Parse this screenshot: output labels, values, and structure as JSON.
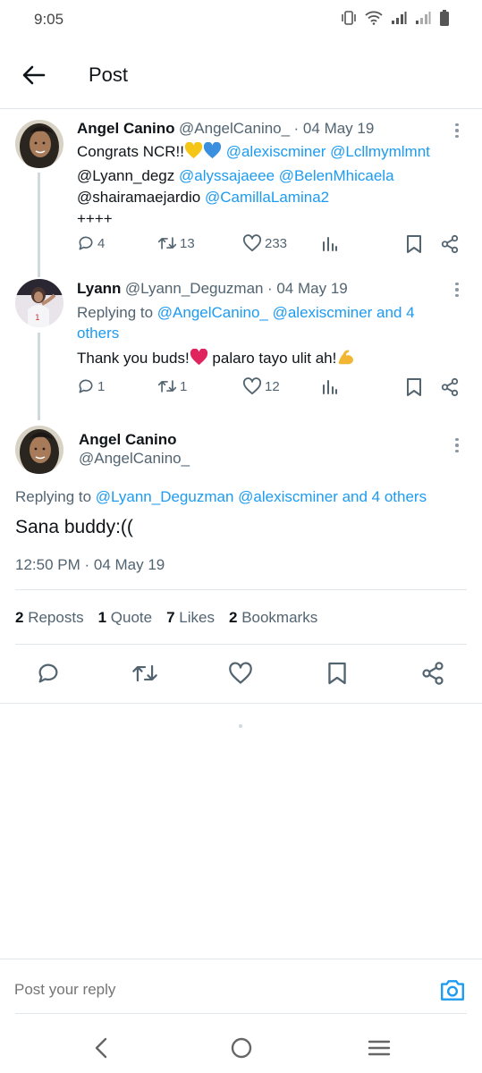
{
  "status_bar": {
    "time": "9:05"
  },
  "header": {
    "title": "Post"
  },
  "tweets": [
    {
      "name": "Angel Canino",
      "handle": "@AngelCanino_",
      "date": "· 04 May 19",
      "text_prefix": "Congrats NCR!!",
      "mentions_line1": "@alexiscminer @Lcllmymlmnt",
      "mentions_line2_plain": "@Lyann_degz",
      "mentions_line2_links": "@alyssajaeee @BelenMhicaela",
      "mentions_line3_plain": "@shairamaejardio",
      "mentions_line3_links": "@CamillaLamina2",
      "text_suffix": "++++",
      "replies": "4",
      "reposts": "13",
      "likes": "233"
    },
    {
      "name": "Lyann",
      "handle": "@Lyann_Deguzman",
      "date": "· 04 May 19",
      "replying_label": "Replying to",
      "replying_links": "@AngelCanino_ @alexiscminer and 4 others",
      "text_main": "Thank you buds!",
      "text_mid": " palaro tayo ulit ah!",
      "replies": "1",
      "reposts": "1",
      "likes": "12"
    }
  ],
  "main_tweet": {
    "name": "Angel Canino",
    "handle": "@AngelCanino_",
    "replying_label": "Replying to",
    "replying_links": "@Lyann_Deguzman @alexiscminer and 4 others",
    "text": "Sana buddy:((",
    "timestamp": "12:50 PM · 04 May 19",
    "stats": {
      "reposts_count": "2",
      "reposts_label": "Reposts",
      "quotes_count": "1",
      "quotes_label": "Quote",
      "likes_count": "7",
      "likes_label": "Likes",
      "bookmarks_count": "2",
      "bookmarks_label": "Bookmarks"
    }
  },
  "reply_bar": {
    "placeholder": "Post your reply"
  },
  "icons": [
    "back-arrow-icon",
    "reply-icon",
    "repost-icon",
    "like-icon",
    "views-icon",
    "bookmark-icon",
    "share-icon",
    "camera-icon",
    "more-icon"
  ],
  "colors": {
    "link": "#1d9bf0",
    "text": "#0f1419",
    "secondary": "#536471",
    "divider": "#e1e6ea"
  }
}
